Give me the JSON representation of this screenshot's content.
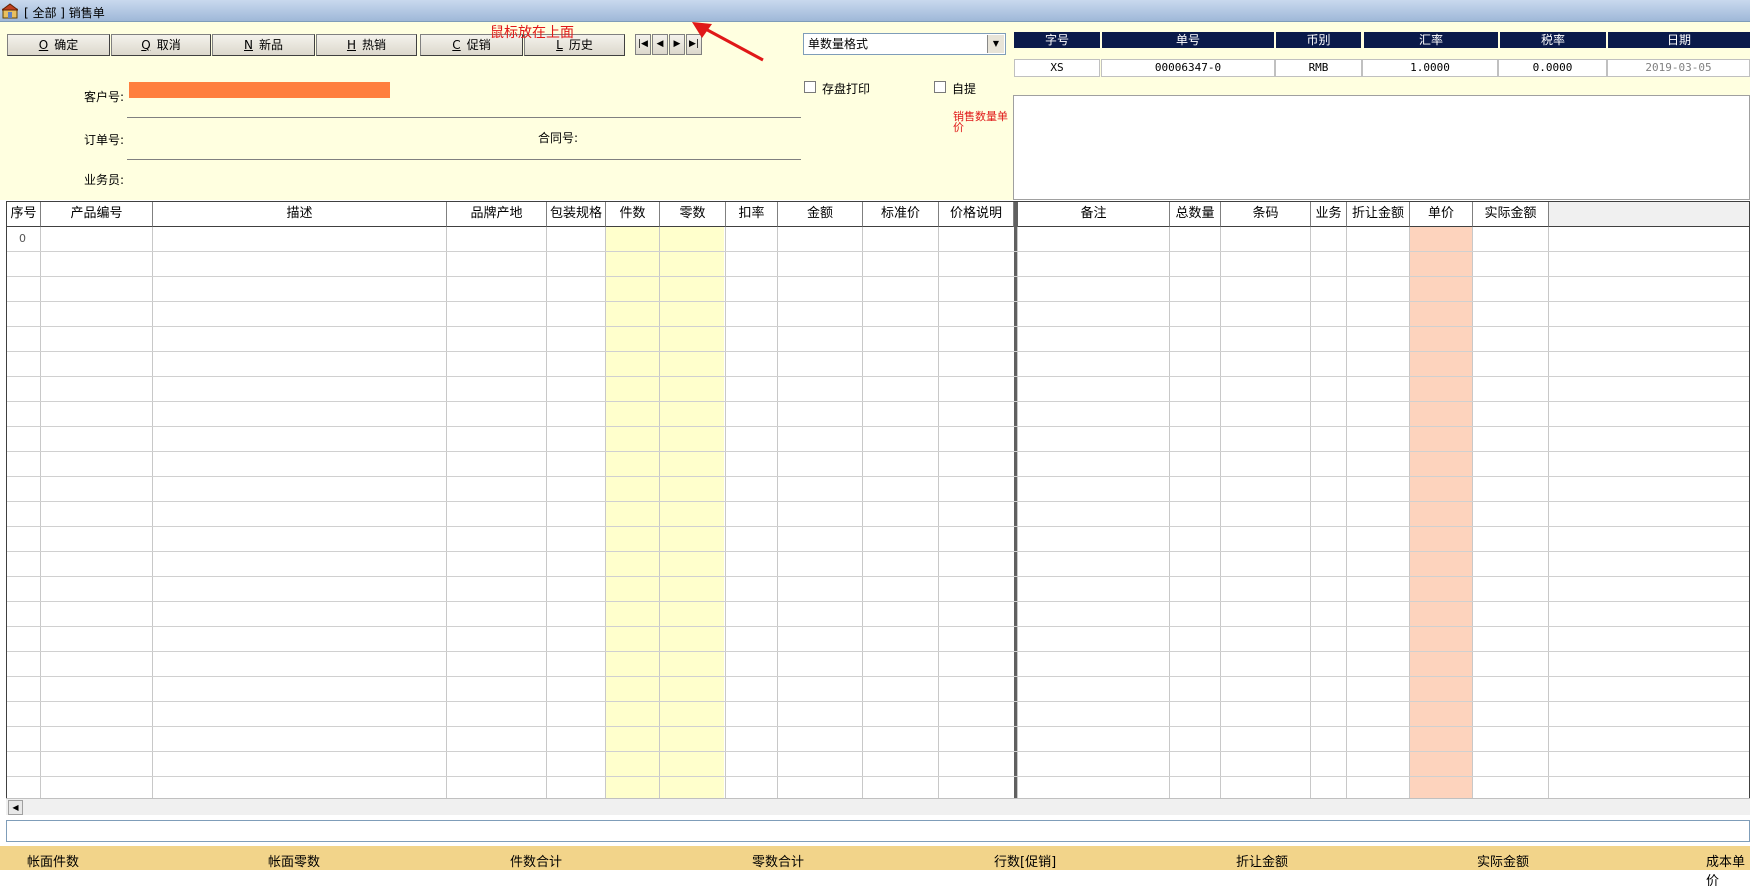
{
  "window": {
    "title": "[ 全部 ] 销售单"
  },
  "annotation": {
    "text": "鼠标放在上面",
    "side_note": "销售数量单价"
  },
  "toolbar": {
    "buttons": [
      {
        "key": "O",
        "label": "确定"
      },
      {
        "key": "Q",
        "label": "取消"
      },
      {
        "key": "N",
        "label": "新品"
      },
      {
        "key": "H",
        "label": "热销"
      },
      {
        "key": "C",
        "label": "促销"
      },
      {
        "key": "L",
        "label": "历史"
      }
    ],
    "nav": [
      "|◀",
      "◀",
      "▶",
      "▶|"
    ]
  },
  "form": {
    "customer_label": "客户号:",
    "order_label": "订单号:",
    "contract_label": "合同号:",
    "salesman_label": "业务员:",
    "customer_color": "#ff7f3f"
  },
  "print_format": {
    "selected": "单数量格式"
  },
  "options": {
    "save_print": "存盘打印",
    "self_pickup": "自提"
  },
  "header_table": {
    "columns": [
      "字号",
      "单号",
      "币别",
      "汇率",
      "税率",
      "日期"
    ],
    "values": [
      "XS",
      "00006347-0",
      "RMB",
      "1.0000",
      "0.0000",
      "2019-03-05"
    ]
  },
  "grid": {
    "left_columns": [
      "序号",
      "产品编号",
      "描述",
      "品牌产地",
      "包装规格",
      "件数",
      "零数",
      "扣率",
      "金额",
      "标准价",
      "价格说明"
    ],
    "right_columns": [
      "备注",
      "总数量",
      "条码",
      "业务",
      "折让金额",
      "单价",
      "实际金额"
    ],
    "first_row_index": "0"
  },
  "footer": {
    "labels": [
      "帐面件数",
      "帐面零数",
      "件数合计",
      "零数合计",
      "行数[促销]",
      "折让金额",
      "实际金额",
      "成本单价"
    ]
  },
  "colors": {
    "form_bg": "#ffffe0",
    "header_bg": "#0a1a4a",
    "yellow_col": "#ffffcc",
    "peach_col": "#fdd3bd",
    "footer_bg": "#f2d48a",
    "annotation": "#e01818"
  }
}
